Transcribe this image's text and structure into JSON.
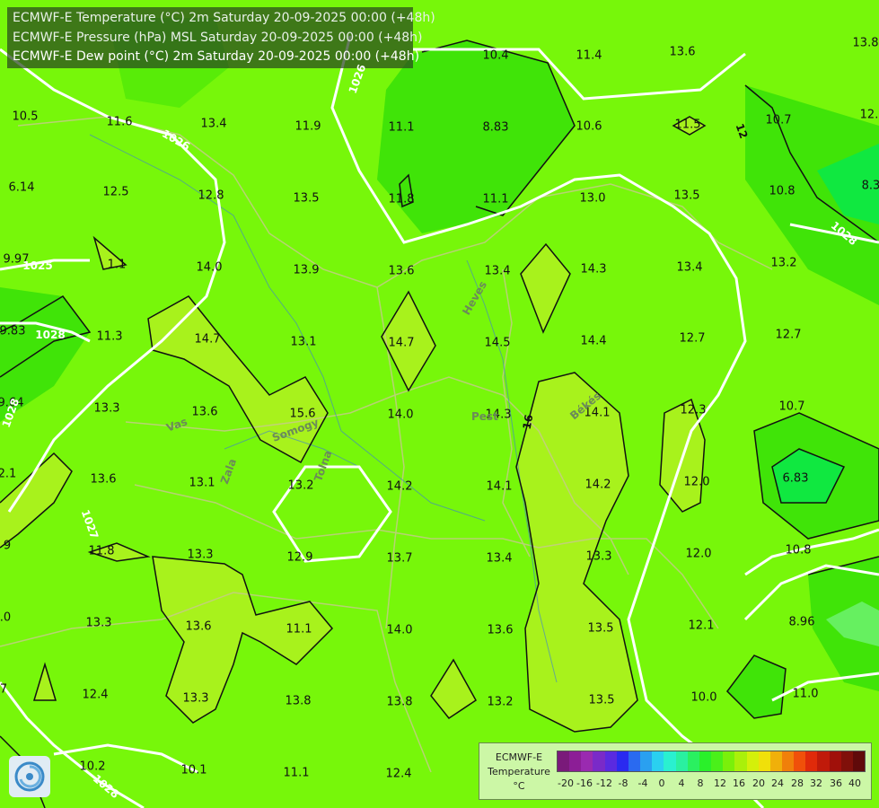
{
  "titles": [
    "ECMWF-E Temperature (°C) 2m Saturday 20-09-2025 00:00 (+48h)",
    "ECMWF-E Pressure (hPa) MSL Saturday 20-09-2025 00:00 (+48h)",
    "ECMWF-E Dew point (°C) 2m Saturday 20-09-2025 00:00 (+48h)"
  ],
  "values": [
    "10.4",
    "11.4",
    "13.6",
    "13.8",
    "10.5",
    "11.6",
    "13.4",
    "11.9",
    "11.1",
    "8.83",
    "10.6",
    "11.5",
    "10.7",
    "12.",
    "6.14",
    "12.5",
    "12.8",
    "13.5",
    "11.8",
    "11.1",
    "13.0",
    "13.5",
    "10.8",
    "8.3",
    "9.97",
    "1.1",
    "14.0",
    "13.9",
    "13.6",
    "13.4",
    "14.3",
    "13.4",
    "13.2",
    "9.83",
    "11.3",
    "14.7",
    "13.1",
    "14.7",
    "14.5",
    "14.4",
    "12.7",
    "12.7",
    "9.64",
    "13.3",
    "13.6",
    "15.6",
    "14.0",
    "14.3",
    "14.1",
    "12.3",
    "10.7",
    "2.1",
    "13.6",
    "13.1",
    "13.2",
    "14.2",
    "14.1",
    "14.2",
    "12.0",
    "6.83",
    "9",
    "11.8",
    "13.3",
    "12.9",
    "13.7",
    "13.4",
    "13.3",
    "12.0",
    "10.8",
    ".0",
    "13.3",
    "13.6",
    "11.1",
    "14.0",
    "13.6",
    "13.5",
    "12.1",
    "8.96",
    "7",
    "12.4",
    "13.3",
    "13.8",
    "13.8",
    "13.2",
    "13.5",
    "10.0",
    "11.0",
    "10.2",
    "10.1",
    "11.1",
    "12.4"
  ],
  "isobars": [
    "1026",
    "1026",
    "1028",
    "1025",
    "1028",
    "1027",
    "1028",
    "1028",
    "16",
    "12"
  ],
  "regions": [
    "Heves",
    "Pest",
    "Békés",
    "Vas",
    "Zala",
    "Somogy",
    "Tolna"
  ],
  "legend": {
    "title": [
      "ECMWF-E",
      "Temperature",
      "°C"
    ],
    "ticks": [
      "-20",
      "-16",
      "-12",
      "-8",
      "-4",
      "0",
      "4",
      "8",
      "12",
      "16",
      "20",
      "24",
      "28",
      "32",
      "36",
      "40"
    ],
    "colors": [
      "#7a1a7a",
      "#8c1e96",
      "#9a2ab0",
      "#7a2ac8",
      "#5a2ae0",
      "#2a2af0",
      "#2a6af0",
      "#2aa0f0",
      "#2ad0f0",
      "#2af0d0",
      "#2af0a0",
      "#2af060",
      "#2af02a",
      "#4af01a",
      "#7af00a",
      "#aaf00a",
      "#d4f00a",
      "#f0e00a",
      "#f0b00a",
      "#f0800a",
      "#f0500a",
      "#e02a0a",
      "#c01a0a",
      "#a0100a",
      "#80100a",
      "#600a0a"
    ]
  },
  "colors": {
    "background": "#77f70a",
    "warm": "#aaf41a",
    "cool": "#33e000",
    "cold": "#00e660"
  }
}
